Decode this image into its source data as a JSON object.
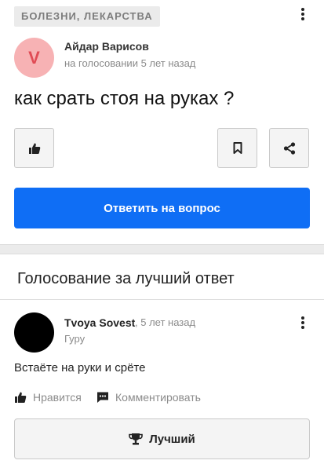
{
  "question_card": {
    "category": "БОЛЕЗНИ, ЛЕКАРСТВА",
    "more_icon": "kebab-vertical-icon",
    "author": {
      "avatar_letter": "V",
      "avatar_bg": "#f7b2b4",
      "avatar_fg": "#e04b55",
      "name": "Айдар Варисов",
      "meta": "на голосовании 5 лет назад"
    },
    "question": "как срать стоя на руках ?",
    "like_icon": "thumb-up-icon",
    "bookmark_icon": "bookmark-icon",
    "share_icon": "share-icon",
    "answer_button": "Ответить на вопрос",
    "accent_color": "#0f6ef5"
  },
  "voting": {
    "title": "Голосование за лучший ответ",
    "answer": {
      "author": "Tvoya Sovest",
      "time": ", 5 лет назад",
      "rank": "Гуру",
      "text": "Встаёте на руки и срёте",
      "like_label": "Нравится",
      "comment_label": "Комментировать",
      "best_label": "Лучший",
      "best_icon": "trophy-icon"
    }
  }
}
